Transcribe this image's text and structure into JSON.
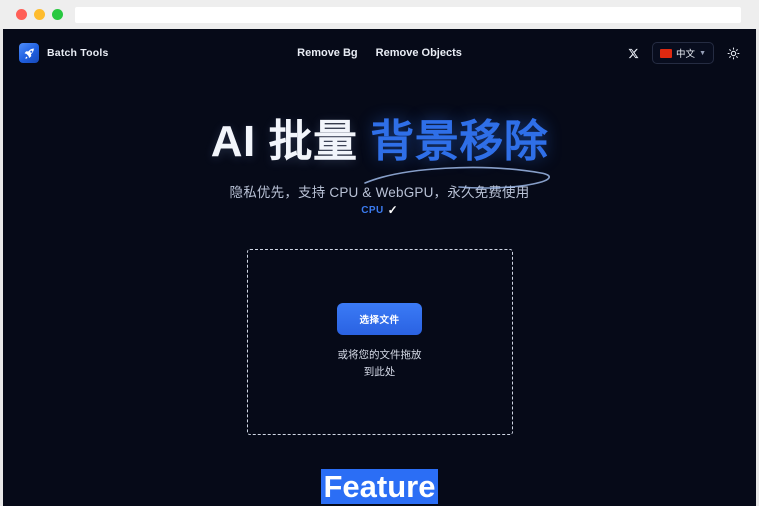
{
  "browser": {
    "traffic_lights": [
      {
        "name": "close",
        "color": "#ff5f57"
      },
      {
        "name": "minimize",
        "color": "#febc2e"
      },
      {
        "name": "maximize",
        "color": "#28c840"
      }
    ],
    "address_bar_value": "",
    "address_bar_placeholder": ""
  },
  "header": {
    "brand": {
      "logo_icon": "rocket-icon",
      "name": "Batch Tools"
    },
    "nav": [
      {
        "label": "Remove Bg"
      },
      {
        "label": "Remove Objects"
      }
    ],
    "actions": {
      "x_icon": "x-twitter-icon",
      "language": {
        "flag_icon": "china-flag-icon",
        "label": "中文",
        "chevron_icon": "chevron-down-icon",
        "flag_color": "#de2910"
      },
      "theme_icon": "sun-icon"
    }
  },
  "hero": {
    "title_plain": "AI 批量",
    "title_accent": "背景移除",
    "accent_color": "#2f6fe8",
    "subtitle": "隐私优先，支持 CPU & WebGPU，永久免费使用",
    "badge": {
      "label": "CPU",
      "check": "✓",
      "label_color": "#3b7bef"
    }
  },
  "dropzone": {
    "button_label": "选择文件",
    "hint_line1": "或将您的文件拖放",
    "hint_line2": "到此处",
    "border_color": "#cfd6e4",
    "button_color": "#3b7bf6"
  },
  "feature_section": {
    "heading": "Feature",
    "selection_color": "#2b6ef5"
  },
  "colors": {
    "page_background": "#060a18",
    "chrome_background": "#eeeeee",
    "accent": "#2b6ef5",
    "text_primary": "#f2f5fb",
    "text_secondary": "#b9c2d6"
  }
}
